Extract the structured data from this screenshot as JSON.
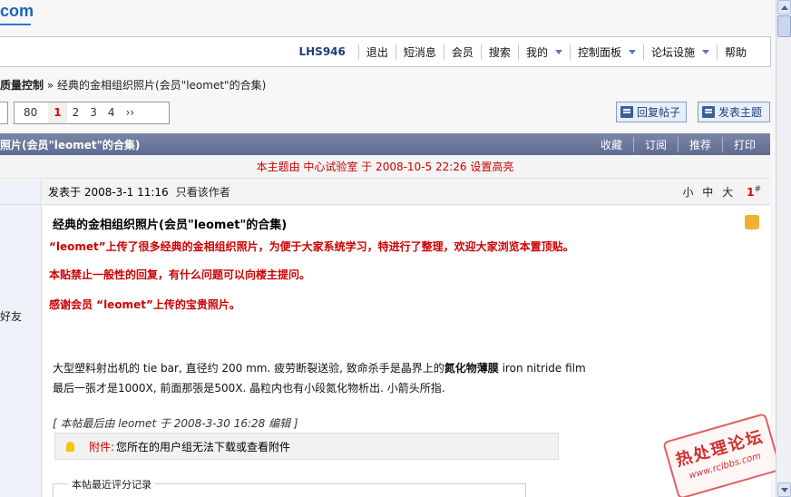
{
  "logo": {
    "text": "com"
  },
  "topnav": {
    "username": "LHS946",
    "items": [
      {
        "label": "退出",
        "dropdown": false
      },
      {
        "label": "短消息",
        "dropdown": false
      },
      {
        "label": "会员",
        "dropdown": false
      },
      {
        "label": "搜索",
        "dropdown": false
      },
      {
        "label": "我的",
        "dropdown": true
      },
      {
        "label": "控制面板",
        "dropdown": true
      },
      {
        "label": "论坛设施",
        "dropdown": true
      },
      {
        "label": "帮助",
        "dropdown": false
      }
    ]
  },
  "breadcrumb": {
    "forum": "质量控制",
    "separator": "»",
    "thread": "经典的金相组织照片(会员\"leomet\"的合集)"
  },
  "pager": {
    "first": "80",
    "pages": [
      "1",
      "2",
      "3",
      "4"
    ],
    "current": "1",
    "next": "››"
  },
  "buttons": {
    "reply": "回复帖子",
    "new_topic": "发表主题"
  },
  "thread_bar": {
    "title": "照片(会员\"leomet\"的合集)",
    "actions": [
      "收藏",
      "订阅",
      "推荐",
      "打印"
    ]
  },
  "highlight_note": "本主题由 中心试验室 于 2008-10-5 22:26 设置高亮",
  "post": {
    "posted": "发表于 2008-3-1 11:16",
    "author_only": "只看该作者",
    "sizes": "小 中 大",
    "floor": "1",
    "floor_mark": "#",
    "title": "经典的金相组织照片(会员\"leomet\"的合集)",
    "red_lines": [
      "“leomet”上传了很多经典的金相组织照片，为便于大家系统学习，特进行了整理，欢迎大家浏览本置顶贴。",
      "本贴禁止一般性的回复，有什么问题可以向楼主提问。",
      "感谢会员 “leomet”上传的宝贵照片。"
    ],
    "body_line1_pre": "大型塑料射出机的  tie bar, 直径约  200 mm. 疲劳断裂送验, 致命杀手是晶界上的",
    "body_line1_bold": "氮化物薄膜",
    "body_line1_post": "  iron nitride film",
    "body_line2": "最后一張才是1000X, 前面那張是500X. 晶粒内也有小段氮化物析出. 小箭头所指.",
    "edited": "[ 本帖最后由  leomet  于  2008-3-30 16:28 编辑  ]",
    "attachment_label": "附件:",
    "attachment_text": "您所在的用户组无法下载或查看附件",
    "rating_legend": "本帖最近评分记录"
  },
  "sidebar": {
    "friend": "好友"
  },
  "stamp": {
    "cn": "热处理论坛",
    "url": "www.rclbbs.com"
  },
  "colors": {
    "accent": "#1f3c7a",
    "highlight_red": "#cc0000",
    "bar": "#6b7799"
  }
}
